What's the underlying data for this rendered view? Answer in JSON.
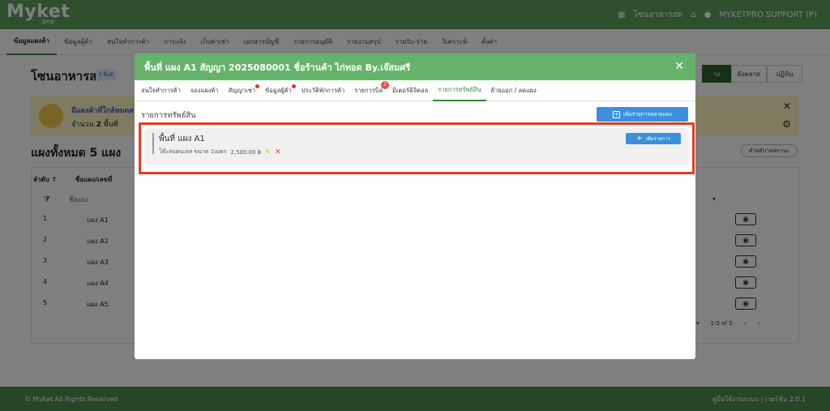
{
  "app": {
    "logo": "Myket",
    "logo_sub": "pro",
    "location": "โซนอาหารสด",
    "user": "MYKETPRO SUPPORT (P)"
  },
  "nav": {
    "items": [
      "ข้อมูลแผงค้า",
      "ข้อมูลผู้ค้า",
      "สนใจทำการค้า",
      "การแจ้ง",
      "เก็บค่าเช่า",
      "เอกสารบัญชี",
      "รายการอนุมัติ",
      "รายงานสรุป",
      "รายรับ-จ่าย",
      "วิเคราะห์",
      "ตั้งค่า"
    ]
  },
  "page": {
    "title": "โซนอาหารสด",
    "badge": "5 พื้นที่",
    "right_tabs": [
      "าง",
      "ผังตลาด",
      "ปฏิทิน"
    ],
    "alert_title": "มีแผงค้าที่ใกล้หมดส",
    "alert_count_label": "จำนวน",
    "alert_count_value": "2",
    "alert_count_unit": "พื้นที่",
    "section_title": "แผงทั้งหมด 5 แผง",
    "help_button": "คำอธิบายสถานะ"
  },
  "table": {
    "col_order": "ลำดับ ↑",
    "col_name": "ชื่อแผง/เลขที่",
    "filter_placeholder": "ชื่อแผง",
    "rows": [
      {
        "num": "1",
        "name": "แผง A1"
      },
      {
        "num": "2",
        "name": "แผง A2"
      },
      {
        "num": "3",
        "name": "แผง A3"
      },
      {
        "num": "4",
        "name": "แผง A4"
      },
      {
        "num": "5",
        "name": "แผง A5"
      }
    ],
    "pager_range": "1-5 of 5"
  },
  "modal": {
    "title": "พื้นที่ แผง A1 สัญญา 2025080001 ชื่อร้านค้า ไก่ทอด By.เจ๊สมศรี",
    "tabs": [
      {
        "label": "สนใจทำการค้า"
      },
      {
        "label": "จองแผงค้า"
      },
      {
        "label": "สัญญาเช่า"
      },
      {
        "label": "ข้อมูลผู้ค้า"
      },
      {
        "label": "ประวัติพักการค้า"
      },
      {
        "label": "รายการบิล",
        "badge": "2"
      },
      {
        "label": "มิเตอร์ดิจิตอล"
      },
      {
        "label": "รายการทรัพย์สิน"
      },
      {
        "label": "ย้ายออก / ลดแผง"
      }
    ],
    "active_tab": "รายการทรัพย์สิน",
    "assets_heading": "รายการทรัพย์สิน",
    "add_multiple_button": "เพิ่มรายการหลายแผง",
    "asset_card": {
      "title": "พื้นที่ แผง A1",
      "item_name": "โต๊ะสแตนเลส ขนาด 1เมตร",
      "item_price": "2,500.00 ฿",
      "add_item_button": "เพิ่มรายการ"
    }
  },
  "footer": {
    "copyright": "© MyKet All Rights Reserved",
    "version": "คู่มือใช้งานระบบ | เวอร์ชั่น 2.0.1"
  },
  "colors": {
    "header_green": "#65b36b",
    "accent_blue": "#3b8fdb",
    "highlight_red": "#e53b1f"
  }
}
